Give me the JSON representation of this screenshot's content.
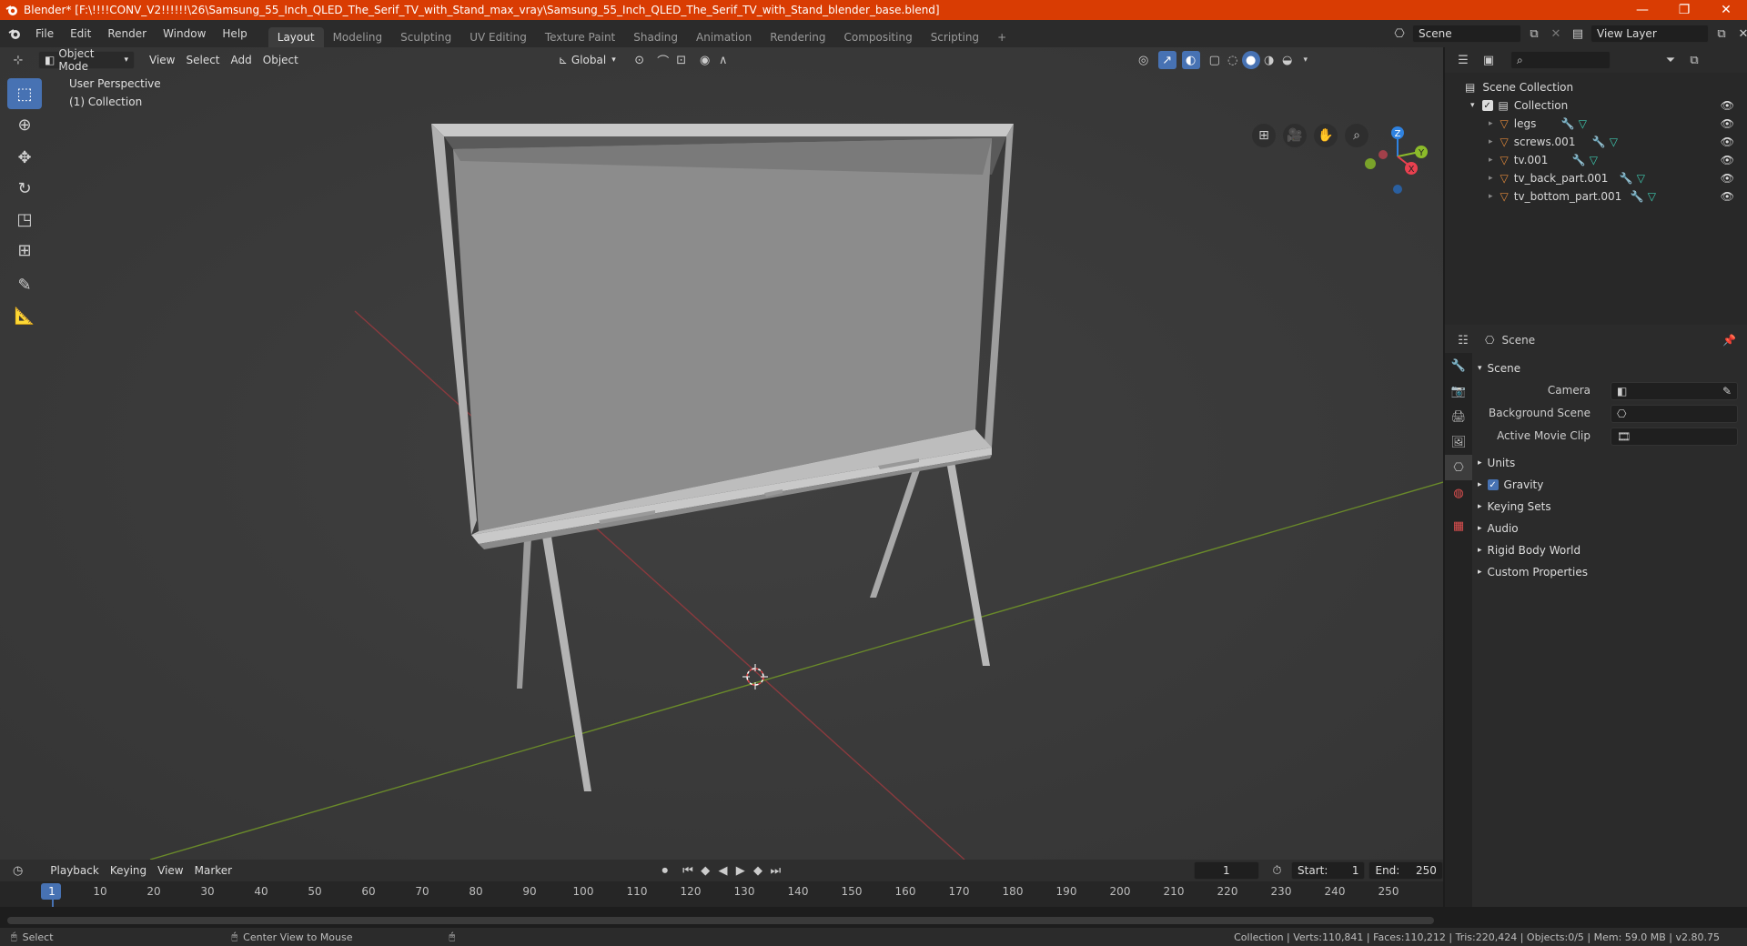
{
  "window": {
    "title": "Blender* [F:\\!!!!CONV_V2!!!!!!\\26\\Samsung_55_Inch_QLED_The_Serif_TV_with_Stand_max_vray\\Samsung_55_Inch_QLED_The_Serif_TV_with_Stand_blender_base.blend]",
    "minimize": "—",
    "restore": "❐",
    "close": "✕"
  },
  "menu": {
    "items": [
      "File",
      "Edit",
      "Render",
      "Window",
      "Help"
    ]
  },
  "workspaces": [
    "Layout",
    "Modeling",
    "Sculpting",
    "UV Editing",
    "Texture Paint",
    "Shading",
    "Animation",
    "Rendering",
    "Compositing",
    "Scripting"
  ],
  "add_tab": "+",
  "scene_field": "Scene",
  "view_layer_field": "View Layer",
  "viewport": {
    "mode": "Object Mode",
    "menus": [
      "View",
      "Select",
      "Add",
      "Object"
    ],
    "orientation": "Global",
    "overlay_line1": "User Perspective",
    "overlay_line2": "(1) Collection",
    "gizmo": {
      "x": "X",
      "y": "Y",
      "z": "Z"
    }
  },
  "outliner": {
    "root": "Scene Collection",
    "collection": "Collection",
    "objects": [
      "legs",
      "screws.001",
      "tv.001",
      "tv_back_part.001",
      "tv_bottom_part.001"
    ]
  },
  "properties": {
    "header": "Scene",
    "section": "Scene",
    "rows": [
      {
        "label": "Camera"
      },
      {
        "label": "Background Scene"
      },
      {
        "label": "Active Movie Clip"
      }
    ],
    "subsections": [
      "Units",
      "Gravity",
      "Keying Sets",
      "Audio",
      "Rigid Body World",
      "Custom Properties"
    ]
  },
  "timeline": {
    "menus": [
      "Playback",
      "Keying",
      "View",
      "Marker"
    ],
    "current_frame": "1",
    "start_label": "Start:",
    "start": "1",
    "end_label": "End:",
    "end": "250",
    "ticks": [
      "1",
      "10",
      "20",
      "30",
      "40",
      "50",
      "60",
      "70",
      "80",
      "90",
      "100",
      "110",
      "120",
      "130",
      "140",
      "150",
      "160",
      "170",
      "180",
      "190",
      "200",
      "210",
      "220",
      "230",
      "240",
      "250"
    ]
  },
  "status": {
    "select": "Select",
    "center_view": "Center View to Mouse",
    "stats": "Collection | Verts:110,841 | Faces:110,212 | Tris:220,424 | Objects:0/5 | Mem: 59.0 MB | v2.80.75"
  },
  "colors": {
    "accent": "#4772b3",
    "titlebar": "#d93c03",
    "x_axis": "#e8404f",
    "y_axis": "#8cbb2a",
    "z_axis": "#2f82e0"
  }
}
